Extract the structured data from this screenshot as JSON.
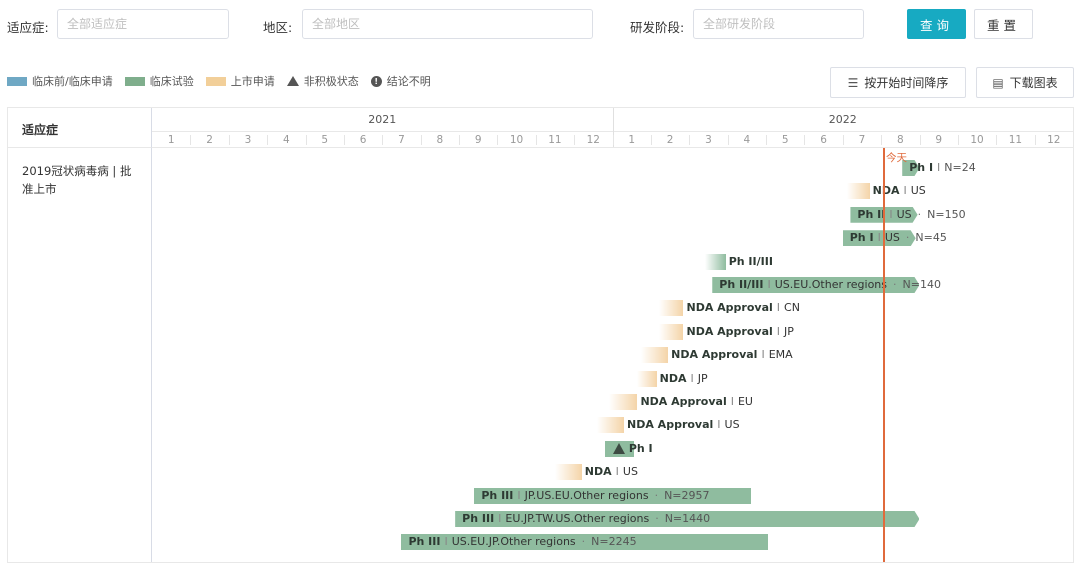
{
  "filters": {
    "indication_label": "适应症:",
    "indication_placeholder": "全部适应症",
    "region_label": "地区:",
    "region_placeholder": "全部地区",
    "phase_label": "研发阶段:",
    "phase_placeholder": "全部研发阶段",
    "query_button": "查询",
    "reset_button": "重置"
  },
  "legend": [
    {
      "label": "临床前/临床申请",
      "color": "#6fa8c4"
    },
    {
      "label": "临床试验",
      "color": "#7fae8c"
    },
    {
      "label": "上市申请",
      "color": "#f2cf99"
    },
    {
      "label": "非积极状态",
      "icon": "triangle-icon"
    },
    {
      "label": "结论不明",
      "icon": "exclamation-circle-icon"
    }
  ],
  "toolbar": {
    "sort_label": "按开始时间降序",
    "download_label": "下载图表"
  },
  "chart": {
    "header_label": "适应症",
    "years": [
      "2021",
      "2022"
    ],
    "months": [
      "1",
      "2",
      "3",
      "4",
      "5",
      "6",
      "7",
      "8",
      "9",
      "10",
      "11",
      "12"
    ],
    "indication": "2019冠状病毒病 | 批准上市",
    "today_label": "今天",
    "today": {
      "year": 2022,
      "month": 8.05
    },
    "colors": {
      "trial": "#8fbc9f",
      "nda": "#f4d4a8",
      "today": "#e06a3c"
    }
  },
  "chart_data": {
    "type": "gantt",
    "x_axis": {
      "years": [
        "2021",
        "2022"
      ],
      "months": [
        "1",
        "2",
        "3",
        "4",
        "5",
        "6",
        "7",
        "8",
        "9",
        "10",
        "11",
        "12"
      ]
    },
    "rows": [
      {
        "kind": "trial",
        "phase": "Ph I",
        "start": "2022-07.5",
        "end": "2022-08.0",
        "region": "",
        "n": "N=24",
        "sep": " I ",
        "style": "solid-arrow",
        "s": 19.55,
        "e": 20.0
      },
      {
        "kind": "nda",
        "phase": "NDA",
        "region": "US",
        "n": "",
        "style": "fade",
        "s": 18.1,
        "e": 18.7
      },
      {
        "kind": "trial",
        "phase": "Ph II",
        "region": "US",
        "n": "N=150",
        "style": "solid-arrow",
        "s": 18.2,
        "e": 19.95
      },
      {
        "kind": "trial",
        "phase": "Ph I",
        "region": "US",
        "n": "N=45",
        "style": "solid-arrow",
        "s": 18.0,
        "e": 19.9
      },
      {
        "kind": "trial",
        "phase": "Ph II/III",
        "region": "",
        "n": "",
        "style": "fade",
        "s": 14.4,
        "e": 14.95
      },
      {
        "kind": "trial",
        "phase": "Ph II/III",
        "region": "US.EU.Other regions",
        "n": "N=140",
        "style": "solid-arrow",
        "s": 14.6,
        "e": 20.0
      },
      {
        "kind": "nda",
        "phase": "NDA Approval",
        "region": "CN",
        "n": "",
        "style": "fade",
        "s": 13.2,
        "e": 13.85
      },
      {
        "kind": "nda",
        "phase": "NDA Approval",
        "region": "JP",
        "n": "",
        "style": "fade",
        "s": 13.2,
        "e": 13.85
      },
      {
        "kind": "nda",
        "phase": "NDA Approval",
        "region": "EMA",
        "n": "",
        "style": "fade",
        "s": 12.75,
        "e": 13.45
      },
      {
        "kind": "nda",
        "phase": "NDA",
        "region": "JP",
        "n": "",
        "style": "fade",
        "s": 12.65,
        "e": 13.15
      },
      {
        "kind": "nda",
        "phase": "NDA Approval",
        "region": "EU",
        "n": "",
        "style": "fade",
        "s": 11.9,
        "e": 12.65
      },
      {
        "kind": "nda",
        "phase": "NDA Approval",
        "region": "US",
        "n": "",
        "style": "fade",
        "s": 11.6,
        "e": 12.3
      },
      {
        "kind": "trial",
        "phase": "Ph I",
        "region": "",
        "n": "",
        "style": "inactive",
        "s": 11.8,
        "e": 12.55
      },
      {
        "kind": "nda",
        "phase": "NDA",
        "region": "US",
        "n": "",
        "style": "fade",
        "s": 10.5,
        "e": 11.2
      },
      {
        "kind": "trial",
        "phase": "Ph III",
        "region": "JP.US.EU.Other regions",
        "n": "N=2957",
        "style": "solid",
        "s": 8.4,
        "e": 15.6
      },
      {
        "kind": "trial",
        "phase": "Ph III",
        "region": "EU.JP.TW.US.Other regions",
        "n": "N=1440",
        "style": "solid-arrow",
        "s": 7.9,
        "e": 20.0
      },
      {
        "kind": "trial",
        "phase": "Ph III",
        "region": "US.EU.JP.Other regions",
        "n": "N=2245",
        "style": "solid",
        "s": 6.5,
        "e": 16.05
      }
    ]
  }
}
